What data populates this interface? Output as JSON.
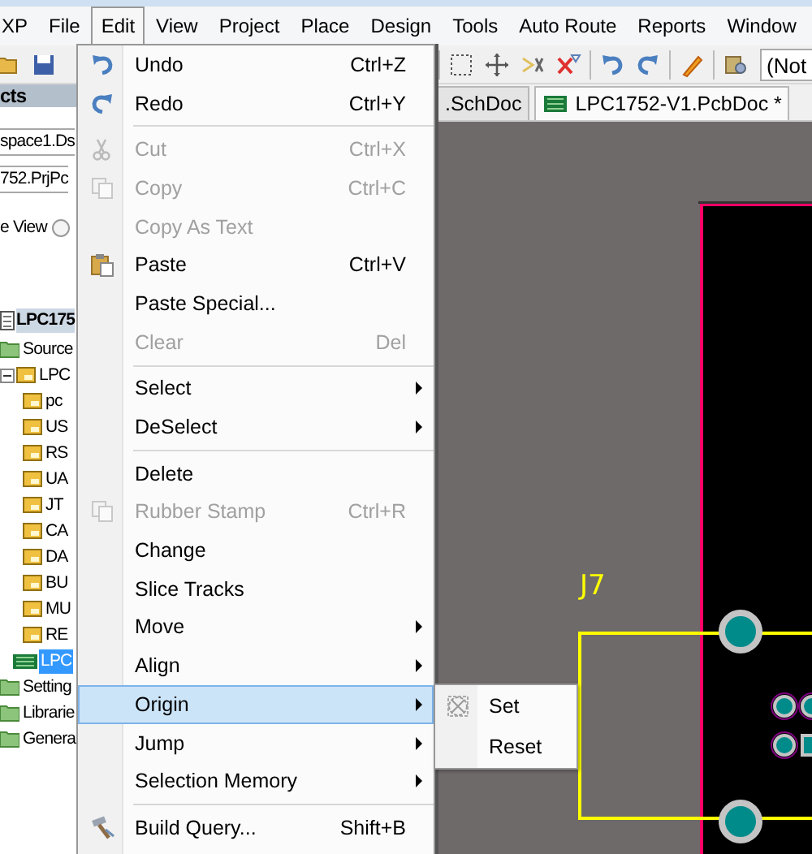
{
  "menubar": [
    {
      "label": "XP",
      "selected": false
    },
    {
      "label": "File",
      "selected": false
    },
    {
      "label": "Edit",
      "selected": true
    },
    {
      "label": "View",
      "selected": false
    },
    {
      "label": "Project",
      "selected": false
    },
    {
      "label": "Place",
      "selected": false
    },
    {
      "label": "Design",
      "selected": false
    },
    {
      "label": "Tools",
      "selected": false
    },
    {
      "label": "Auto Route",
      "selected": false
    },
    {
      "label": "Reports",
      "selected": false
    },
    {
      "label": "Window",
      "selected": false
    }
  ],
  "toolbar": {
    "filter_field": "(Not"
  },
  "document_tabs": [
    {
      "label": ".SchDoc",
      "selected": false
    },
    {
      "label": "LPC1752-V1.PcbDoc *",
      "selected": true
    }
  ],
  "projects_panel": {
    "title": "cts",
    "workspace_field": "space1.Ds",
    "project_field": "752.PrjPc",
    "view_option": {
      "label": "e View",
      "selected": false
    },
    "tree": [
      {
        "label": "LPC175",
        "selected": true,
        "kind": "project",
        "children": [
          {
            "label": "Source",
            "selected": false,
            "kind": "group",
            "children": [
              {
                "label": "LPC",
                "selected": false,
                "kind": "sheet",
                "expanded": true,
                "children": [
                  {
                    "label": "pc",
                    "selected": false,
                    "kind": "sheet"
                  },
                  {
                    "label": "US",
                    "selected": false,
                    "kind": "sheet"
                  },
                  {
                    "label": "RS",
                    "selected": false,
                    "kind": "sheet"
                  },
                  {
                    "label": "UA",
                    "selected": false,
                    "kind": "sheet"
                  },
                  {
                    "label": "JT",
                    "selected": false,
                    "kind": "sheet"
                  },
                  {
                    "label": "CA",
                    "selected": false,
                    "kind": "sheet"
                  },
                  {
                    "label": "DA",
                    "selected": false,
                    "kind": "sheet"
                  },
                  {
                    "label": "BU",
                    "selected": false,
                    "kind": "sheet"
                  },
                  {
                    "label": "MU",
                    "selected": false,
                    "kind": "sheet"
                  },
                  {
                    "label": "RE",
                    "selected": false,
                    "kind": "sheet"
                  }
                ]
              },
              {
                "label": "LPC",
                "selected": true,
                "kind": "pcb"
              }
            ]
          },
          {
            "label": "Setting",
            "selected": false,
            "kind": "group"
          },
          {
            "label": "Librarie",
            "selected": false,
            "kind": "group"
          },
          {
            "label": "Genera",
            "selected": false,
            "kind": "group"
          }
        ]
      }
    ]
  },
  "edit_menu": {
    "groups": [
      [
        {
          "label": "Undo",
          "shortcut": "Ctrl+Z",
          "disabled": false,
          "submenu": false,
          "selected": false
        },
        {
          "label": "Redo",
          "shortcut": "Ctrl+Y",
          "disabled": false,
          "submenu": false,
          "selected": false
        }
      ],
      [
        {
          "label": "Cut",
          "shortcut": "Ctrl+X",
          "disabled": true,
          "submenu": false,
          "selected": false
        },
        {
          "label": "Copy",
          "shortcut": "Ctrl+C",
          "disabled": true,
          "submenu": false,
          "selected": false
        },
        {
          "label": "Copy As Text",
          "disabled": true,
          "submenu": false,
          "selected": false
        },
        {
          "label": "Paste",
          "shortcut": "Ctrl+V",
          "disabled": false,
          "submenu": false,
          "selected": false
        },
        {
          "label": "Paste Special...",
          "disabled": false,
          "submenu": false,
          "selected": false
        },
        {
          "label": "Clear",
          "shortcut": "Del",
          "disabled": true,
          "submenu": false,
          "selected": false
        }
      ],
      [
        {
          "label": "Select",
          "disabled": false,
          "submenu": true,
          "selected": false
        },
        {
          "label": "DeSelect",
          "disabled": false,
          "submenu": true,
          "selected": false
        }
      ],
      [
        {
          "label": "Delete",
          "disabled": false,
          "submenu": false,
          "selected": false
        },
        {
          "label": "Rubber Stamp",
          "shortcut": "Ctrl+R",
          "disabled": true,
          "submenu": false,
          "selected": false
        },
        {
          "label": "Change",
          "disabled": false,
          "submenu": false,
          "selected": false
        },
        {
          "label": "Slice Tracks",
          "disabled": false,
          "submenu": false,
          "selected": false
        },
        {
          "label": "Move",
          "disabled": false,
          "submenu": true,
          "selected": false
        },
        {
          "label": "Align",
          "disabled": false,
          "submenu": true,
          "selected": false
        },
        {
          "label": "Origin",
          "disabled": false,
          "submenu": true,
          "selected": true
        },
        {
          "label": "Jump",
          "disabled": false,
          "submenu": true,
          "selected": false
        },
        {
          "label": "Selection Memory",
          "disabled": false,
          "submenu": true,
          "selected": false
        }
      ],
      [
        {
          "label": "Build Query...",
          "shortcut": "Shift+B",
          "disabled": false,
          "submenu": false,
          "selected": false
        }
      ]
    ]
  },
  "origin_submenu": [
    {
      "label": "Set"
    },
    {
      "label": "Reset"
    }
  ],
  "pcb": {
    "designator": "J7"
  }
}
